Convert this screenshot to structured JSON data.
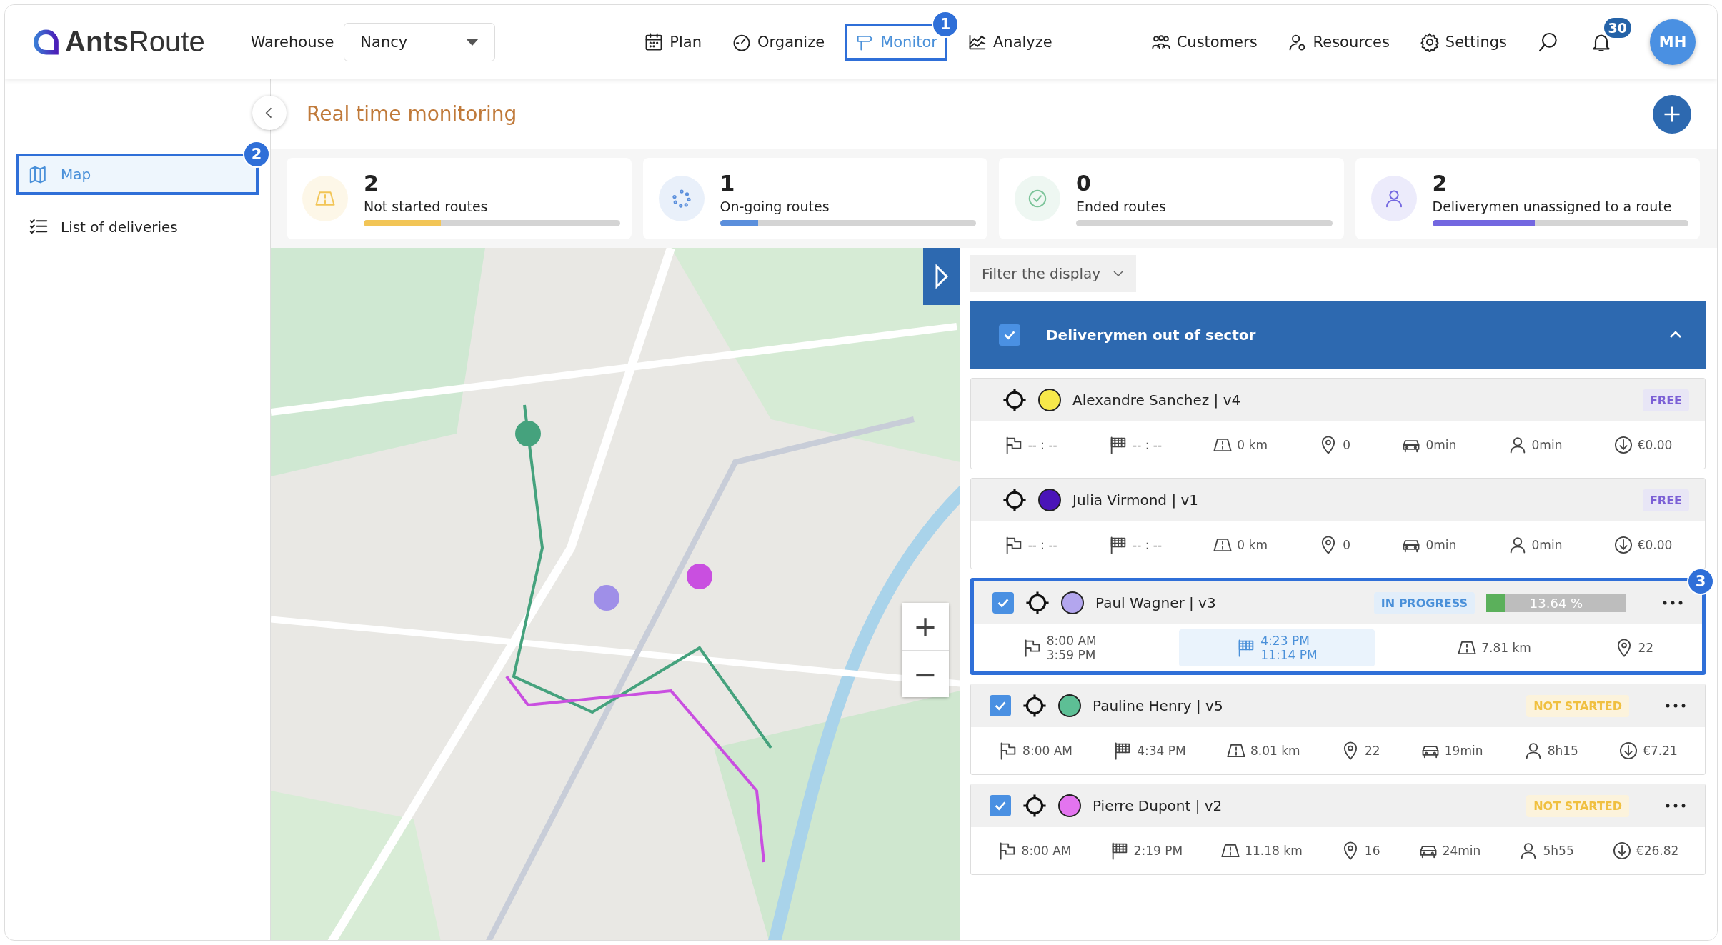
{
  "header": {
    "logo": "**Ants**Route",
    "warehouse_label": "Warehouse",
    "warehouse": "Nancy",
    "nav": [
      {
        "label": "Plan",
        "selected": false
      },
      {
        "label": "Organize",
        "selected": false
      },
      {
        "label": "Monitor",
        "selected": true,
        "callout": "1"
      },
      {
        "label": "Analyze",
        "selected": false
      }
    ],
    "nav_right": [
      {
        "label": "Customers"
      },
      {
        "label": "Resources"
      },
      {
        "label": "Settings"
      }
    ],
    "notifications": "30",
    "avatar": "MH"
  },
  "sidebar": {
    "items": [
      {
        "label": "Map",
        "selected": true,
        "callout": "2"
      },
      {
        "label": "List of deliveries",
        "selected": false
      }
    ]
  },
  "page_title": "Real time monitoring",
  "stats": [
    {
      "value": "2",
      "label": "Not started routes",
      "color": "#f2c556",
      "level": 0.3
    },
    {
      "value": "1",
      "label": "On-going routes",
      "color": "#5b8fdc",
      "level": 0.15
    },
    {
      "value": "0",
      "label": "Ended routes",
      "color": "#7cc49a",
      "level": 0
    },
    {
      "value": "2",
      "label": "Deliverymen unassigned to a route",
      "color": "#7367e0",
      "level": 0.4
    }
  ],
  "map": {
    "kind": "picture",
    "zoom_in": "+",
    "zoom_out": "−"
  },
  "filter": "Filter the display",
  "group": {
    "title": "Deliverymen out of sector",
    "checked": true,
    "expanded": true
  },
  "routes": [
    {
      "kind": "unassigned",
      "name": "Alexandre Sanchez | v4",
      "color": "#f7e84a",
      "status": {
        "kind": "free",
        "label": "FREE"
      },
      "stats": [
        {
          "kind": "start",
          "value": "-- : --"
        },
        {
          "kind": "end",
          "value": "-- : --"
        },
        {
          "kind": "distance",
          "value": "0 km"
        },
        {
          "kind": "stops",
          "value": "0"
        },
        {
          "kind": "drive",
          "value": "0min"
        },
        {
          "kind": "work",
          "value": "0min"
        },
        {
          "kind": "cost",
          "value": "€0.00"
        }
      ]
    },
    {
      "kind": "unassigned",
      "name": "Julia Virmond | v1",
      "color": "#4a14b8",
      "status": {
        "kind": "free",
        "label": "FREE"
      },
      "stats": [
        {
          "kind": "start",
          "value": "-- : --"
        },
        {
          "kind": "end",
          "value": "-- : --"
        },
        {
          "kind": "distance",
          "value": "0 km"
        },
        {
          "kind": "stops",
          "value": "0"
        },
        {
          "kind": "drive",
          "value": "0min"
        },
        {
          "kind": "work",
          "value": "0min"
        },
        {
          "kind": "cost",
          "value": "€0.00"
        }
      ]
    },
    {
      "kind": "assigned",
      "checked": true,
      "name": "Paul Wagner | v3",
      "color": "#b3a6ee",
      "callout": "3",
      "status": {
        "kind": "in_progress",
        "label": "IN PROGRESS"
      },
      "progress": {
        "level": 0.1364,
        "reading": "13.64 %"
      },
      "stats": [
        {
          "kind": "start",
          "planned": "8:00 AM",
          "value": "3:59 PM",
          "highlighted": false
        },
        {
          "kind": "end",
          "planned": "4:23 PM",
          "value": "11:14 PM",
          "highlighted": true
        },
        {
          "kind": "distance",
          "value": "7.81 km"
        },
        {
          "kind": "stops",
          "value": "22"
        }
      ]
    },
    {
      "kind": "assigned",
      "checked": true,
      "name": "Pauline Henry | v5",
      "color": "#5dbf95",
      "status": {
        "kind": "not_started",
        "label": "NOT STARTED"
      },
      "stats": [
        {
          "kind": "start",
          "value": "8:00 AM"
        },
        {
          "kind": "end",
          "value": "4:34 PM"
        },
        {
          "kind": "distance",
          "value": "8.01 km"
        },
        {
          "kind": "stops",
          "value": "22"
        },
        {
          "kind": "drive",
          "value": "19min"
        },
        {
          "kind": "work",
          "value": "8h15"
        },
        {
          "kind": "cost",
          "value": "€7.21"
        }
      ]
    },
    {
      "kind": "assigned",
      "checked": true,
      "name": "Pierre Dupont | v2",
      "color": "#e374ef",
      "status": {
        "kind": "not_started",
        "label": "NOT STARTED"
      },
      "stats": [
        {
          "kind": "start",
          "value": "8:00 AM"
        },
        {
          "kind": "end",
          "value": "2:19 PM"
        },
        {
          "kind": "distance",
          "value": "11.18 km"
        },
        {
          "kind": "stops",
          "value": "16"
        },
        {
          "kind": "drive",
          "value": "24min"
        },
        {
          "kind": "work",
          "value": "5h55"
        },
        {
          "kind": "cost",
          "value": "€26.82"
        }
      ]
    }
  ]
}
